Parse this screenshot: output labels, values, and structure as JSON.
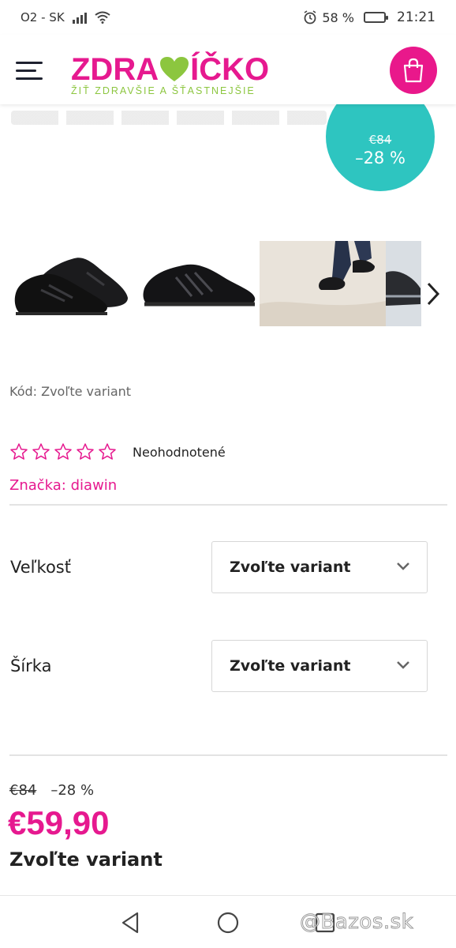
{
  "status_bar": {
    "carrier": "O2 - SK",
    "battery_percent": "58 %",
    "battery_level": 0.58,
    "time": "21:21",
    "icons": [
      "signal-icon",
      "wifi-icon",
      "alarm-icon",
      "battery-icon"
    ]
  },
  "header": {
    "logo_text_left": "ZDRA",
    "logo_text_right": "ÍČKO",
    "logo_tagline": "ŽIŤ ZDRAVŠIE A ŠŤASTNEJŠIE",
    "menu_icon": "hamburger-menu-icon",
    "cart_icon": "shopping-bag-icon"
  },
  "colors": {
    "brand_pink": "#e6198f",
    "brand_green": "#8cc63f",
    "badge_teal": "#2ec5c0"
  },
  "badge": {
    "old_price": "€84",
    "discount": "–28 %"
  },
  "gallery": {
    "thumbnails": [
      "black-sneakers-pair",
      "black-sneaker-side",
      "walking-on-sand",
      "sneaker-detail"
    ],
    "next_icon": "chevron-right-icon"
  },
  "product": {
    "code": "Kód: Zvoľte variant",
    "rating": 0,
    "rating_max": 5,
    "rating_text": "Neohodnotené",
    "brand_label": "Značka:",
    "brand_value": "diawin"
  },
  "options": [
    {
      "label": "Veľkosť",
      "selected": "Zvoľte variant"
    },
    {
      "label": "Šírka",
      "selected": "Zvoľte variant"
    }
  ],
  "price": {
    "old": "€84",
    "discount": "–28 %",
    "current": "€59,90",
    "note": "Zvoľte variant"
  },
  "watermark": "@Bazos.sk"
}
